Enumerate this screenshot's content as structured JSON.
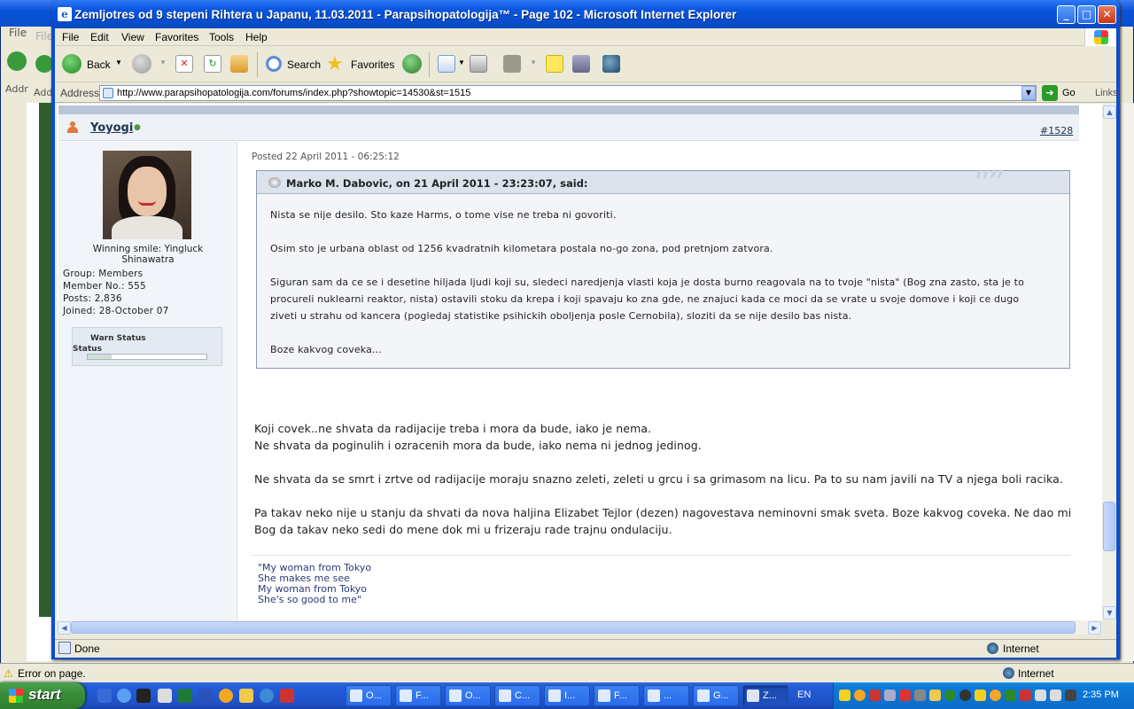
{
  "bg_window": {
    "menu_file": "File",
    "toolbar_add": "Add",
    "address_label": "Addr",
    "status_text": "Error on page.",
    "zone": "Internet"
  },
  "window": {
    "title": "Zemljotres od 9 stepeni Rihtera u Japanu, 11.03.2011 - Parapsihopatologija™ - Page 102 - Microsoft Internet Explorer",
    "btn_min": "_",
    "btn_max": "□",
    "btn_close": "✕"
  },
  "menubar": {
    "items": [
      "File",
      "Edit",
      "View",
      "Favorites",
      "Tools",
      "Help"
    ]
  },
  "toolbar": {
    "back_label": "Back",
    "search_label": "Search",
    "favorites_label": "Favorites"
  },
  "address": {
    "label": "Address",
    "url": "http://www.parapsihopatologija.com/forums/index.php?showtopic=14530&st=1515",
    "go_label": "Go",
    "links_label": "Links"
  },
  "post": {
    "author": "Yoyogi",
    "post_number": "#1528",
    "posted": "Posted 22 April 2011 - 06:25:12",
    "avatar_caption": "Winning smile: Yingluck Shinawatra",
    "group": "Group:  Members",
    "member_no": "Member No.:  555",
    "posts": "Posts:  2,836",
    "joined": "Joined:  28-October 07",
    "warn_title": "Warn Status",
    "warn_sub": "Status",
    "warn_level": 0.2,
    "quote_title": "Marko M. Dabovic, on 21 April 2011 - 23:23:07, said:",
    "quote_lines": [
      "Nista se nije desilo. Sto kaze Harms, o tome vise ne treba ni govoriti.",
      "Osim sto je urbana oblast od 1256 kvadratnih kilometara postala no-go zona, pod pretnjom zatvora.",
      "Siguran sam da ce se i desetine hiljada ljudi koji su, sledeci naredjenja vlasti koja je dosta burno reagovala na to tvoje \"nista\" (Bog zna zasto, sta je to",
      "procureli nuklearni reaktor, nista) ostavili stoku da krepa i koji spavaju ko zna gde, ne znajuci kada ce moci da se vrate u svoje domove i koji ce dugo",
      "ziveti u strahu od kancera (pogledaj statistike psihickih oboljenja posle Cernobila), sloziti da se nije desilo bas nista.",
      "Boze kakvog coveka..."
    ],
    "body_lines": [
      "Koji covek..ne shvata da radijacije treba i mora da bude, iako je nema.",
      "Ne shvata da poginulih i ozracenih mora da bude, iako nema ni jednog jedinog.",
      "Ne shvata da se smrt i zrtve od radijacije moraju snazno zeleti, zeleti u grcu i sa grimasom na licu. Pa to su nam javili na TV a njega boli racika.",
      "Pa takav neko nije u stanju da shvati da nova haljina Elizabet Tejlor (dezen) nagovestava neminovni smak sveta. Boze kakvog coveka. Ne dao mi",
      "Bog da takav neko sedi do mene dok mi u frizeraju rade trajnu ondulaciju."
    ],
    "signature_lines": [
      "\"My woman from Tokyo",
      "She makes me see",
      "My woman from Tokyo",
      "She's so good to me\""
    ]
  },
  "statusbar": {
    "status": "Done",
    "zone": "Internet"
  },
  "taskbar": {
    "start_label": "start",
    "tasks": [
      "O...",
      "F...",
      "O...",
      "C...",
      "I...",
      "F...",
      "...",
      "G...",
      "Z..."
    ],
    "language": "EN",
    "clock": "2:35 PM"
  }
}
